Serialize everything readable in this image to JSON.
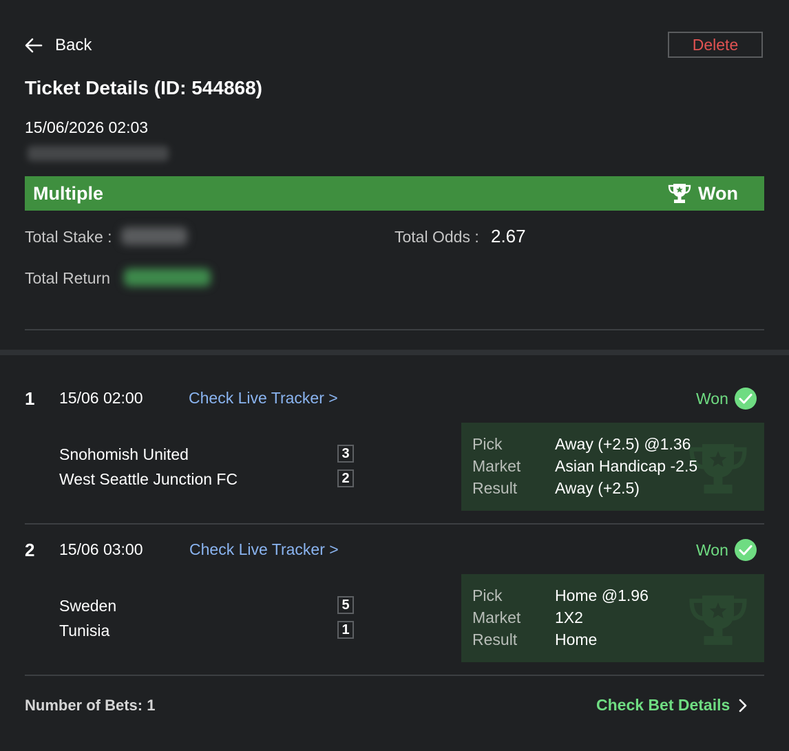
{
  "header": {
    "back_label": "Back",
    "delete_label": "Delete",
    "title": "Ticket Details (ID: 544868)",
    "datetime": "15/06/2026 02:03"
  },
  "bet": {
    "type": "Multiple",
    "status": "Won",
    "total_stake_label": "Total Stake :",
    "total_odds_label": "Total Odds :",
    "total_odds_value": "2.67",
    "total_return_label": "Total Return"
  },
  "legs": [
    {
      "number": "1",
      "time": "15/06 02:00",
      "tracker_label": "Check Live Tracker >",
      "status": "Won",
      "home_team": "Snohomish United",
      "home_score": "3",
      "away_team": "West Seattle Junction FC",
      "away_score": "2",
      "pick_label": "Pick",
      "pick_value": "Away (+2.5) @1.36",
      "market_label": "Market",
      "market_value": "Asian Handicap -2.5",
      "result_label": "Result",
      "result_value": "Away (+2.5)"
    },
    {
      "number": "2",
      "time": "15/06 03:00",
      "tracker_label": "Check Live Tracker >",
      "status": "Won",
      "home_team": "Sweden",
      "home_score": "5",
      "away_team": "Tunisia",
      "away_score": "1",
      "pick_label": "Pick",
      "pick_value": "Home @1.96",
      "market_label": "Market",
      "market_value": "1X2",
      "result_label": "Result",
      "result_value": "Home"
    }
  ],
  "footer": {
    "number_of_bets": "Number of Bets: 1",
    "check_details_label": "Check Bet Details"
  },
  "colors": {
    "won_banner": "#3f8f3f",
    "won_text": "#6fdc82",
    "link": "#8ab4f0",
    "delete": "#e05252",
    "pick_box": "#253a2a"
  }
}
